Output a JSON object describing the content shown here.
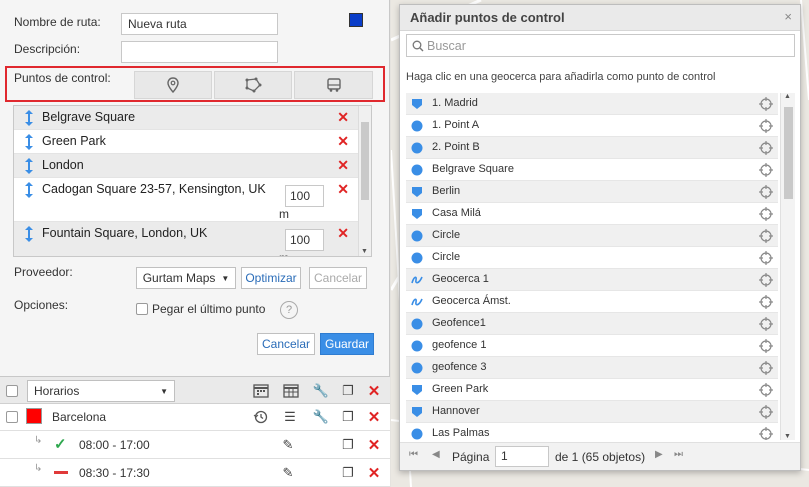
{
  "route_form": {
    "name_label": "Nombre de ruta:",
    "name_value": "Nueva ruta",
    "desc_label": "Descripción:",
    "desc_value": "",
    "route_color": "#0a3dc9",
    "checkpoints_label": "Puntos de control:",
    "checkpoint_tabs": [
      {
        "icon": "map-pin-icon"
      },
      {
        "icon": "polygon-icon"
      },
      {
        "icon": "bus-icon"
      }
    ],
    "checkpoints": [
      {
        "name": "Belgrave Square",
        "radius": null
      },
      {
        "name": "Green Park",
        "radius": null
      },
      {
        "name": "London",
        "radius": null
      },
      {
        "name": "Cadogan Square 23-57, Kensington, UK",
        "radius": "100",
        "unit": "m"
      },
      {
        "name": "Fountain Square, London, UK",
        "radius": "100",
        "unit": "m"
      }
    ],
    "provider_label": "Proveedor:",
    "provider_value": "Gurtam Maps",
    "optimize_label": "Optimizar",
    "cancel_small_label": "Cancelar",
    "options_label": "Opciones:",
    "stick_last_label": "Pegar el último punto",
    "cancel_label": "Cancelar",
    "save_label": "Guardar"
  },
  "bottom_list": {
    "filter_value": "Horarios",
    "route_name": "Barcelona",
    "route_color": "#ff0000",
    "schedules": [
      {
        "time": "08:00 - 17:00",
        "status": "active"
      },
      {
        "time": "08:30 - 17:30",
        "status": "inactive"
      }
    ]
  },
  "dialog": {
    "title": "Añadir puntos de control",
    "close": "×",
    "search_placeholder": "Buscar",
    "hint": "Haga clic en una geocerca para añadirla como punto de control",
    "geofences": [
      {
        "name": "1. Madrid",
        "icon": "pentagon"
      },
      {
        "name": "1. Point A",
        "icon": "circle"
      },
      {
        "name": "2. Point B",
        "icon": "circle"
      },
      {
        "name": "Belgrave Square",
        "icon": "circle"
      },
      {
        "name": "Berlin",
        "icon": "pentagon"
      },
      {
        "name": "Casa Milá",
        "icon": "pentagon"
      },
      {
        "name": "Circle",
        "icon": "circle"
      },
      {
        "name": "Circle",
        "icon": "circle"
      },
      {
        "name": "Geocerca 1",
        "icon": "line"
      },
      {
        "name": "Geocerca Ámst.",
        "icon": "line"
      },
      {
        "name": "Geofence1",
        "icon": "circle"
      },
      {
        "name": "geofence 1",
        "icon": "circle"
      },
      {
        "name": "geofence 3",
        "icon": "circle"
      },
      {
        "name": "Green Park",
        "icon": "pentagon"
      },
      {
        "name": "Hannover",
        "icon": "pentagon"
      },
      {
        "name": "Las Palmas",
        "icon": "circle"
      }
    ],
    "pager": {
      "page_label": "Página",
      "page_value": "1",
      "of_label": "de 1 (65 objetos)"
    }
  }
}
